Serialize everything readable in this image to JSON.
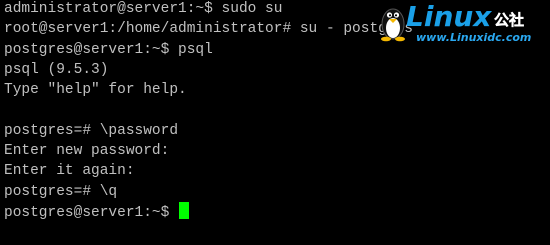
{
  "terminal": {
    "lines": [
      "administrator@server1:~$ sudo su",
      "root@server1:/home/administrator# su - postgres",
      "postgres@server1:~$ psql",
      "psql (9.5.3)",
      "Type \"help\" for help.",
      "",
      "postgres=# \\password",
      "Enter new password:",
      "Enter it again:",
      "postgres=# \\q",
      "postgres@server1:~$ "
    ],
    "text_color": "#c0c0c0",
    "background_color": "#000000",
    "cursor_color": "#00ff00"
  },
  "watermark": {
    "brand": "Linux",
    "suffix": "公社",
    "url": "www.Linuxidc.com",
    "brand_color": "#1aa0e8",
    "url_color": "#2aa8f0",
    "icon": "tux-penguin-icon"
  }
}
